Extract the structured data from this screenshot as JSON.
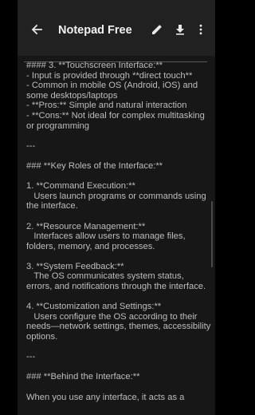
{
  "app_bar": {
    "title": "Notepad Free",
    "icons": {
      "back": "arrow-back-icon",
      "edit": "pencil-icon",
      "download": "download-icon",
      "more": "more-vert-icon"
    }
  },
  "editor": {
    "text": "#### 3. **Touchscreen Interface:**\n- Input is provided through **direct touch**\n- Common in mobile OS (Android, iOS) and some desktops/laptops\n- **Pros:** Simple and natural interaction\n- **Cons:** Not ideal for complex multitasking or programming\n\n---\n\n### **Key Roles of the Interface:**\n\n1. **Command Execution:**\n   Users launch programs or commands using the interface.\n\n2. **Resource Management:**\n   Interfaces allow users to manage files, folders, memory, and processes.\n\n3. **System Feedback:**\n   The OS communicates system status, errors, and notifications through the interface.\n\n4. **Customization and Settings:**\n   Users configure the OS according to their needs—network settings, themes, accessibility options.\n\n---\n\n### **Behind the Interface:**\n\nWhen you use any interface, it acts as a"
  },
  "colors": {
    "background": "#000000",
    "app_bar": "#212121",
    "editor_bg": "#171717",
    "text": "#bdbdbd",
    "title": "#f2f2f2"
  }
}
